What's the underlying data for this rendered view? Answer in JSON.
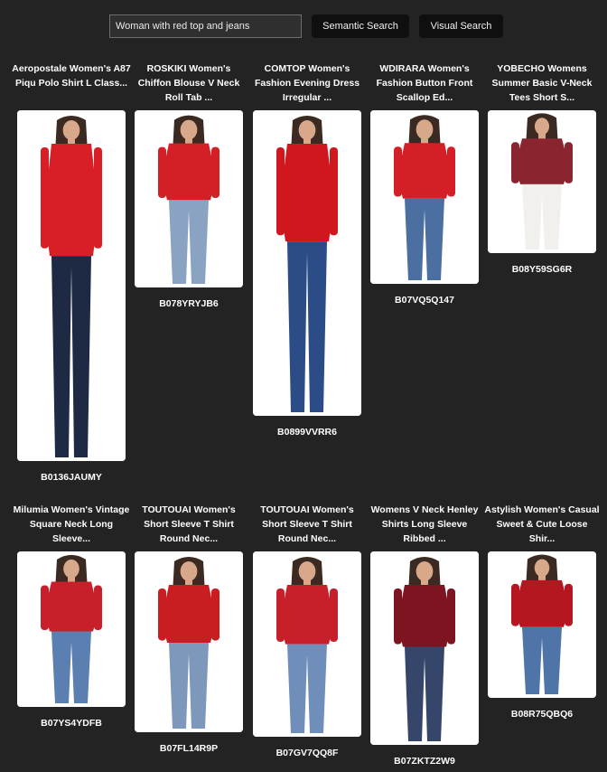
{
  "search": {
    "query": "Woman with red top and jeans",
    "semantic_label": "Semantic Search",
    "visual_label": "Visual Search"
  },
  "products": [
    {
      "title": "Aeropostale Women's A87 Piqu Polo Shirt L Class...",
      "asin": "B0136JAUMY",
      "icon": "woman-red-polo-jeans",
      "top_color": "#d91f26",
      "bottom_color": "#1e2a44"
    },
    {
      "title": "ROSKIKI Women's Chiffon Blouse V Neck Roll Tab ...",
      "asin": "B078YRYJB6",
      "icon": "woman-red-blouse-ripped-jeans",
      "top_color": "#d41f26",
      "bottom_color": "#8aa3c2"
    },
    {
      "title": "COMTOP Women's Fashion Evening Dress Irregular ...",
      "asin": "B0899VVRR6",
      "icon": "woman-red-high-low-dress",
      "top_color": "#d0171e",
      "bottom_color": "#2b4c86"
    },
    {
      "title": "WDIRARA Women's Fashion Button Front Scallop Ed...",
      "asin": "B07VQ5Q147",
      "icon": "woman-red-scallop-top",
      "top_color": "#d41f26",
      "bottom_color": "#4a6fa0"
    },
    {
      "title": "YOBECHO Womens Summer Basic V-Neck Tees Short S...",
      "asin": "B08Y59SG6R",
      "icon": "woman-maroon-tee-white-shorts",
      "top_color": "#8a2530",
      "bottom_color": "#f2f0ec"
    },
    {
      "title": "Milumia Women's Vintage Square Neck Long Sleeve...",
      "asin": "B07YS4YDFB",
      "icon": "woman-red-square-neck-top",
      "top_color": "#c8202b",
      "bottom_color": "#5a7fb0"
    },
    {
      "title": "TOUTOUAI Women's Short Sleeve T Shirt Round Nec...",
      "asin": "B07FL14R9P",
      "icon": "woman-red-tee-denim-shorts",
      "top_color": "#c91d22",
      "bottom_color": "#7d98bb"
    },
    {
      "title": "TOUTOUAI Women's Short Sleeve T Shirt Round Nec...",
      "asin": "B07GV7QQ8F",
      "icon": "woman-red-striped-top-shorts",
      "top_color": "#c8202b",
      "bottom_color": "#6f8fba"
    },
    {
      "title": "Womens V Neck Henley Shirts Long Sleeve Ribbed ...",
      "asin": "B07ZKTZ2W9",
      "icon": "woman-maroon-henley-jeans",
      "top_color": "#7e1422",
      "bottom_color": "#35466a"
    },
    {
      "title": "Astylish Women's Casual Sweet & Cute Loose Shir...",
      "asin": "B08R75QBQ6",
      "icon": "woman-red-loose-shirt-jeans",
      "top_color": "#b5161f",
      "bottom_color": "#4f74a8"
    }
  ]
}
